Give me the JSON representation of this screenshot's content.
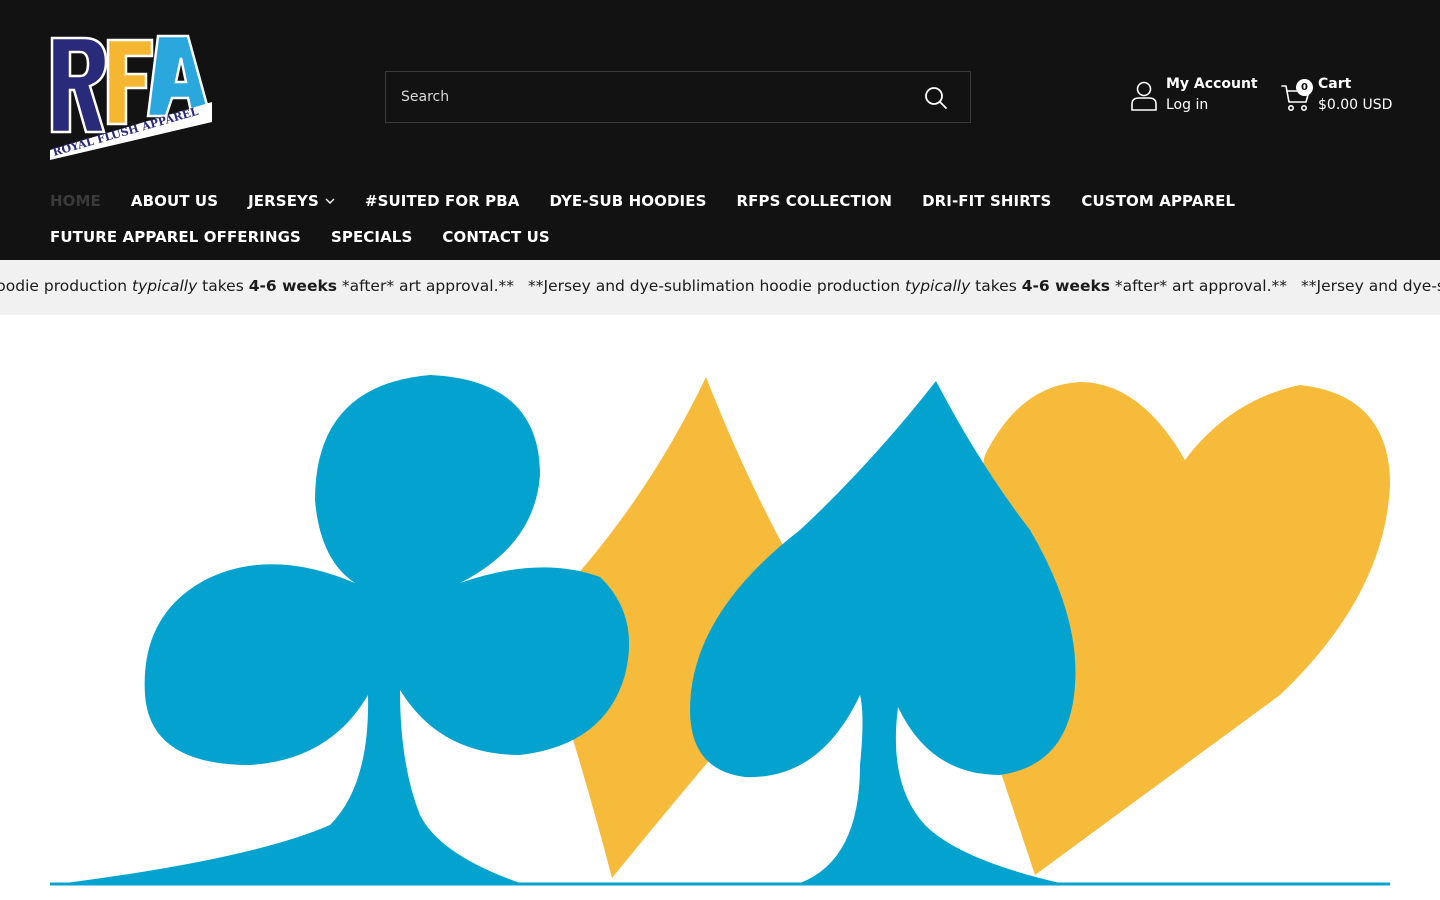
{
  "brand": {
    "logo_text": "RFA",
    "logo_subtext": "ROYAL FLUSH APPAREL",
    "colors": {
      "navy": "#2a2a7a",
      "gold": "#f5b731",
      "sky": "#2aa7dc"
    }
  },
  "search": {
    "placeholder": "Search"
  },
  "account": {
    "title": "My Account",
    "subtitle": "Log in"
  },
  "cart": {
    "count": "0",
    "title": "Cart",
    "total": "$0.00 USD"
  },
  "nav": {
    "row1": [
      {
        "label": "HOME",
        "active": true
      },
      {
        "label": "ABOUT US"
      },
      {
        "label": "JERSEYS",
        "has_dropdown": true
      },
      {
        "label": "#SUITED FOR PBA"
      },
      {
        "label": "DYE-SUB HOODIES"
      },
      {
        "label": "RFPS COLLECTION"
      },
      {
        "label": "DRI-FIT SHIRTS"
      },
      {
        "label": "CUSTOM APPAREL"
      }
    ],
    "row2": [
      {
        "label": "FUTURE APPAREL OFFERINGS"
      },
      {
        "label": "SPECIALS"
      },
      {
        "label": "CONTACT US"
      }
    ]
  },
  "announcement": {
    "prefix": "**Jersey and dye-sublimation hoodie production ",
    "emphasis": "typically",
    "middle": " takes ",
    "bold": "4-6 weeks",
    "suffix": " *after* art approval.**"
  },
  "hero": {
    "description": "Card suit shapes: club, diamond, spade, heart",
    "colors": {
      "blue": "#04a3cf",
      "gold": "#f6bb3b"
    }
  }
}
